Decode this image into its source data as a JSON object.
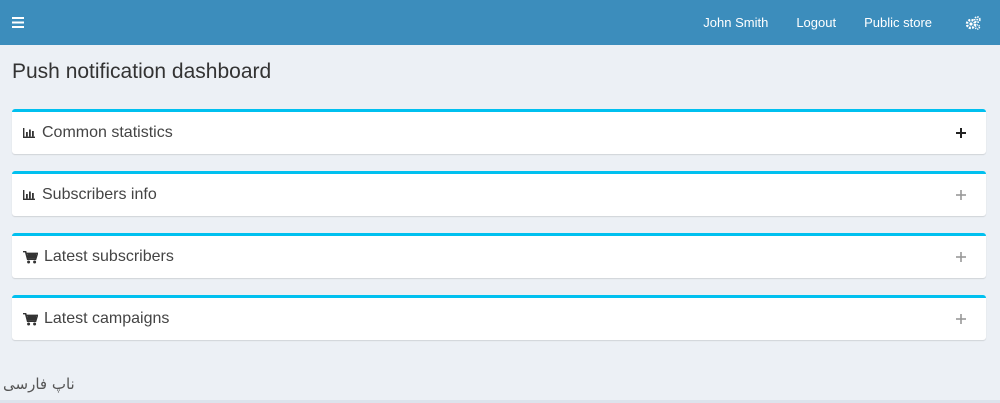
{
  "topbar": {
    "bg_color": "#3c8dbc",
    "menu_icon": "hamburger-icon",
    "user_name": "John Smith",
    "logout_label": "Logout",
    "public_store_label": "Public store",
    "settings_icon": "gears-icon"
  },
  "page": {
    "title": "Push notification dashboard"
  },
  "boxes": [
    {
      "title": "Common statistics",
      "icon": "bar-chart-icon",
      "toggle": "+"
    },
    {
      "title": "Subscribers info",
      "icon": "bar-chart-icon",
      "toggle": "+"
    },
    {
      "title": "Latest subscribers",
      "icon": "cart-icon",
      "toggle": "+"
    },
    {
      "title": "Latest campaigns",
      "icon": "cart-icon",
      "toggle": "+"
    }
  ],
  "box_accent_color": "#00c0ef",
  "watermark": "ناپ فارسی"
}
